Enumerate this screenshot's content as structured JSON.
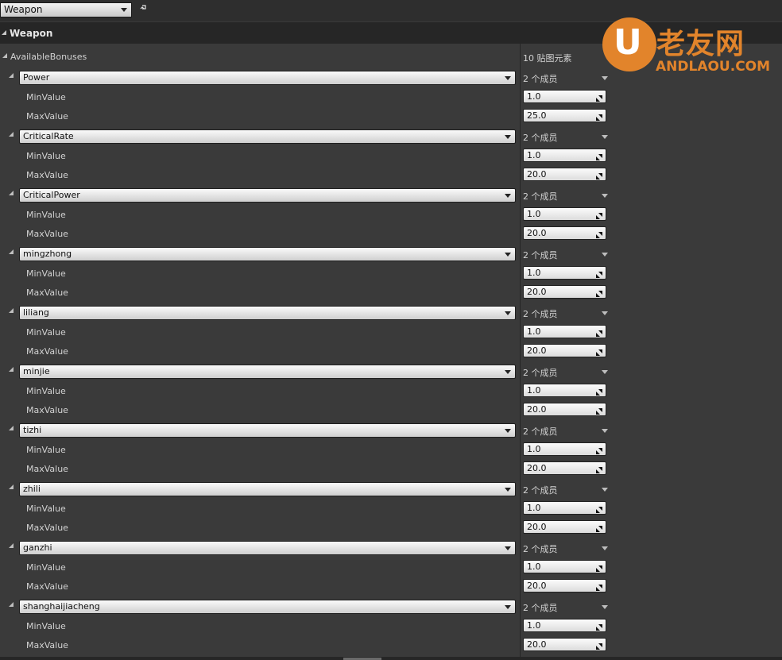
{
  "toolbar": {
    "asset_selected": "Weapon"
  },
  "category": {
    "title": "Weapon"
  },
  "map": {
    "name": "AvailableBonuses",
    "count_label": "10 贴图元素"
  },
  "watermark": {
    "cn_text": "老友网",
    "en_text": "ANDLAOU.COM",
    "color": "#e2842b"
  },
  "entries": [
    {
      "key": "Power",
      "members": "2 个成员",
      "min_label": "MinValue",
      "min": "1.0",
      "max_label": "MaxValue",
      "max": "25.0"
    },
    {
      "key": "CriticalRate",
      "members": "2 个成员",
      "min_label": "MinValue",
      "min": "1.0",
      "max_label": "MaxValue",
      "max": "20.0"
    },
    {
      "key": "CriticalPower",
      "members": "2 个成员",
      "min_label": "MinValue",
      "min": "1.0",
      "max_label": "MaxValue",
      "max": "20.0"
    },
    {
      "key": "mingzhong",
      "members": "2 个成员",
      "min_label": "MinValue",
      "min": "1.0",
      "max_label": "MaxValue",
      "max": "20.0"
    },
    {
      "key": "liliang",
      "members": "2 个成员",
      "min_label": "MinValue",
      "min": "1.0",
      "max_label": "MaxValue",
      "max": "20.0"
    },
    {
      "key": "minjie",
      "members": "2 个成员",
      "min_label": "MinValue",
      "min": "1.0",
      "max_label": "MaxValue",
      "max": "20.0"
    },
    {
      "key": "tizhi",
      "members": "2 个成员",
      "min_label": "MinValue",
      "min": "1.0",
      "max_label": "MaxValue",
      "max": "20.0"
    },
    {
      "key": "zhili",
      "members": "2 个成员",
      "min_label": "MinValue",
      "min": "1.0",
      "max_label": "MaxValue",
      "max": "20.0"
    },
    {
      "key": "ganzhi",
      "members": "2 个成员",
      "min_label": "MinValue",
      "min": "1.0",
      "max_label": "MaxValue",
      "max": "20.0"
    },
    {
      "key": "shanghaijiacheng",
      "members": "2 个成员",
      "min_label": "MinValue",
      "min": "1.0",
      "max_label": "MaxValue",
      "max": "20.0"
    }
  ]
}
